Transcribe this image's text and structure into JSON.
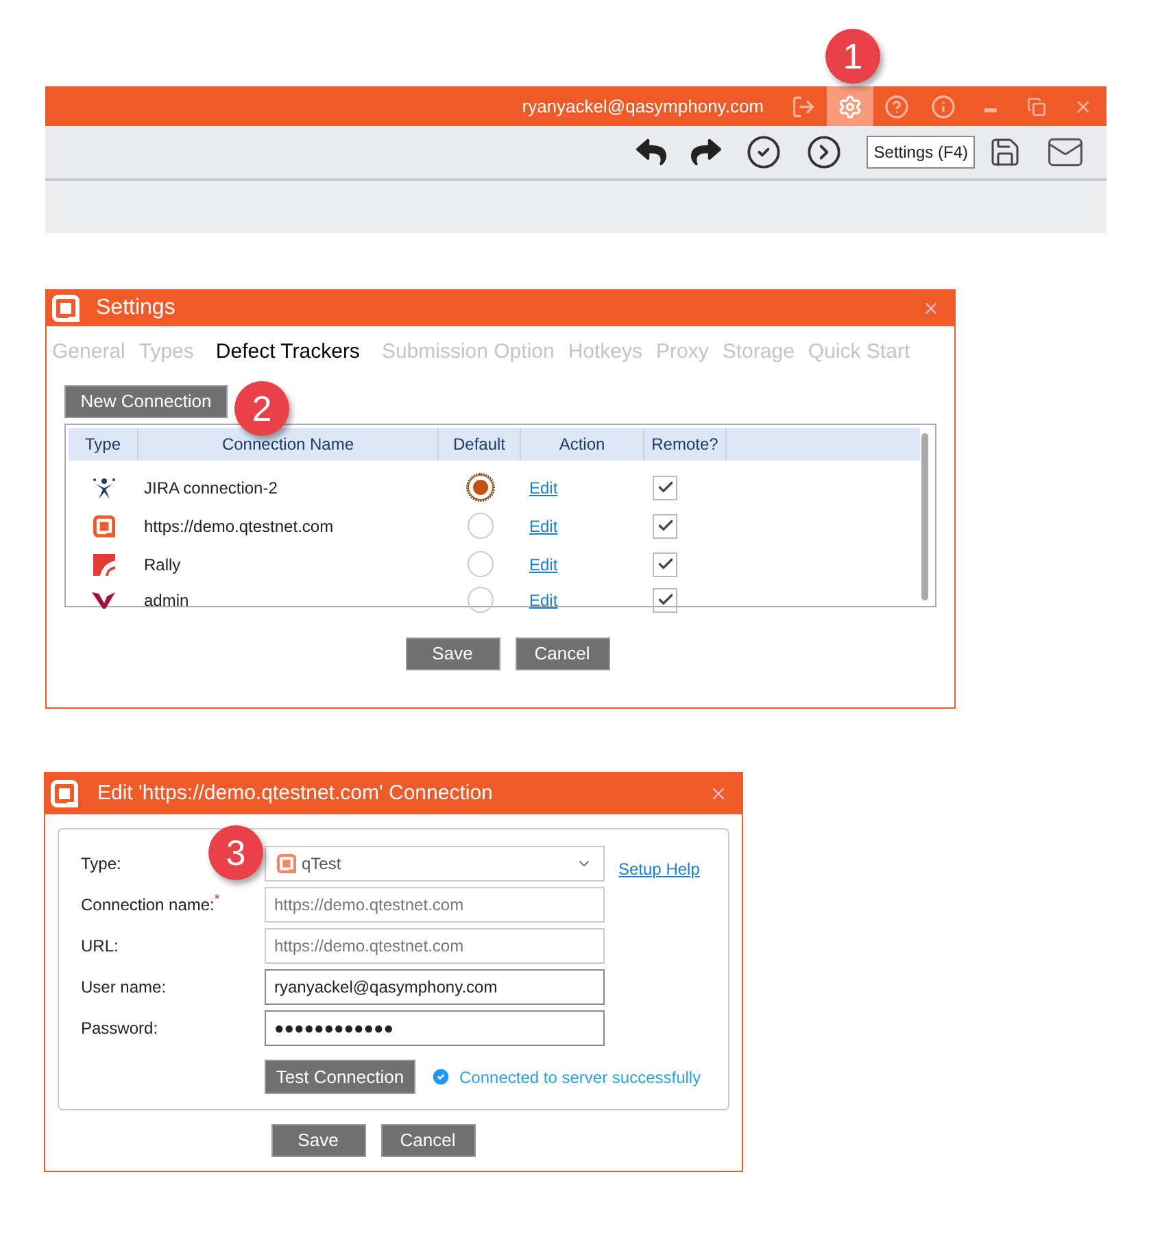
{
  "app_window": {
    "user": "ryanyackel@qasymphony.com",
    "step_badge": "1",
    "title_icons": [
      {
        "kind": "logout",
        "selected": false
      },
      {
        "kind": "settings",
        "selected": true
      },
      {
        "kind": "help",
        "selected": false
      },
      {
        "kind": "info",
        "selected": false
      },
      {
        "kind": "minimize",
        "selected": false
      },
      {
        "kind": "restore",
        "selected": false
      },
      {
        "kind": "close",
        "selected": false
      }
    ],
    "toolbar": [
      {
        "kind": "undo"
      },
      {
        "kind": "redo"
      },
      {
        "kind": "check"
      },
      {
        "kind": "next"
      }
    ],
    "tooltip": "Settings (F4)",
    "toolbar_end": [
      {
        "kind": "save"
      },
      {
        "kind": "mail"
      }
    ]
  },
  "settings_dialog": {
    "title": "Settings",
    "tabs": [
      {
        "label": "General",
        "selected": false
      },
      {
        "label": "Types",
        "selected": false
      },
      {
        "label": "Defect Trackers",
        "selected": true
      },
      {
        "label": "Submission Option",
        "selected": false
      },
      {
        "label": "Hotkeys",
        "selected": false
      },
      {
        "label": "Proxy",
        "selected": false
      },
      {
        "label": "Storage",
        "selected": false
      },
      {
        "label": "Quick Start",
        "selected": false
      }
    ],
    "new_connection_button": "New Connection",
    "step_badge": "2",
    "table": {
      "columns": [
        "Type",
        "Connection Name",
        "Default",
        "Action",
        "Remote?"
      ],
      "rows": [
        {
          "kind": "jira",
          "name": "JIRA connection-2",
          "selected": true,
          "action": "Edit",
          "remote": true
        },
        {
          "kind": "qtest",
          "name": "https://demo.qtestnet.com",
          "selected": false,
          "action": "Edit",
          "remote": true
        },
        {
          "kind": "rally",
          "name": "Rally",
          "selected": false,
          "action": "Edit",
          "remote": true
        },
        {
          "kind": "versionone",
          "name": "admin",
          "selected": false,
          "action": "Edit",
          "remote": true
        }
      ]
    },
    "buttons": [
      "Save",
      "Cancel"
    ]
  },
  "edit_dialog": {
    "title": "Edit 'https://demo.qtestnet.com' Connection",
    "step_badge": "3",
    "type": {
      "label": "Type:",
      "value": "qTest"
    },
    "setup_help": "Setup Help",
    "fields": [
      {
        "label": "Connection name:",
        "required": true,
        "value": "https://demo.qtestnet.com",
        "disabled": true
      },
      {
        "label": "URL:",
        "required": false,
        "value": "https://demo.qtestnet.com",
        "disabled": true
      },
      {
        "label": "User name:",
        "required": false,
        "value": "ryanyackel@qasymphony.com",
        "disabled": false
      },
      {
        "label": "Password:",
        "required": false,
        "value": "●●●●●●●●●●●●",
        "disabled": false
      }
    ],
    "required_mark": "*",
    "test_button": "Test Connection",
    "status": "Connected to server successfully",
    "buttons": [
      "Save",
      "Cancel"
    ]
  }
}
